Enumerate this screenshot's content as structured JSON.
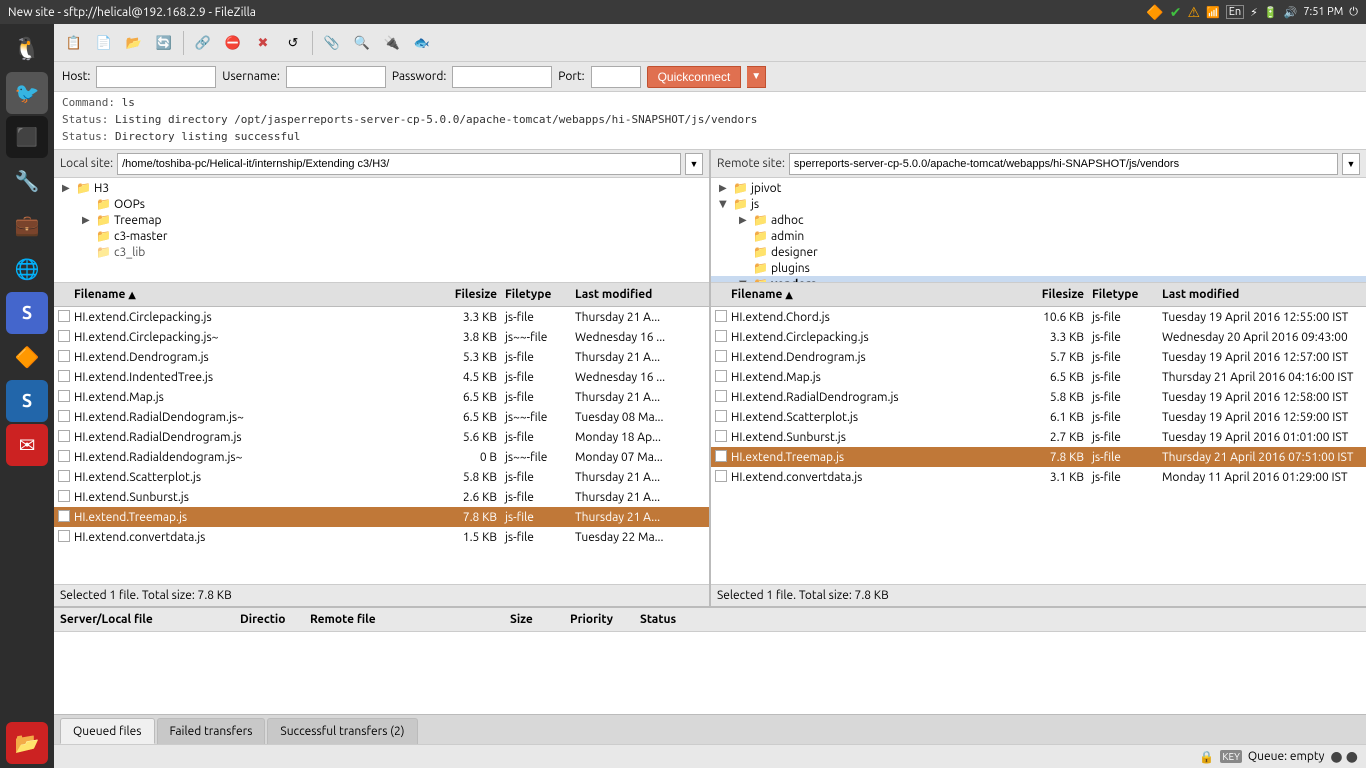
{
  "window": {
    "title": "New site - sftp://helical@192.168.2.9 - FileZilla"
  },
  "titlebar": {
    "time": "7:51 PM"
  },
  "toolbar": {
    "buttons": [
      "⚙",
      "📋",
      "▤",
      "🔁",
      "←",
      "→",
      "⛔",
      "✖",
      "↺",
      "📎",
      "🔍",
      "🔌",
      "🔒"
    ]
  },
  "connection": {
    "host_label": "Host:",
    "host_value": "",
    "username_label": "Username:",
    "username_value": "",
    "password_label": "Password:",
    "password_value": "",
    "port_label": "Port:",
    "port_value": "",
    "quickconnect": "Quickconnect"
  },
  "log": {
    "lines": [
      {
        "type": "command",
        "text": "Command:  ls"
      },
      {
        "type": "status",
        "label": "Status:",
        "text": "Listing directory /opt/jasperreports-server-cp-5.0.0/apache-tomcat/webapps/hi-SNAPSHOT/js/vendors"
      },
      {
        "type": "status",
        "label": "Status:",
        "text": "Directory listing successful"
      }
    ]
  },
  "local_pane": {
    "label": "Local site:",
    "path": "/home/toshiba-pc/Helical-it/internship/Extending c3/H3/",
    "tree": [
      {
        "level": 0,
        "arrow": "▶",
        "name": "H3",
        "expanded": false
      },
      {
        "level": 1,
        "arrow": "",
        "name": "OOPs",
        "expanded": false
      },
      {
        "level": 1,
        "arrow": "▶",
        "name": "Treemap",
        "expanded": false
      },
      {
        "level": 1,
        "arrow": "",
        "name": "c3-master",
        "expanded": false
      },
      {
        "level": 1,
        "arrow": "",
        "name": "c3_lib",
        "expanded": false
      }
    ],
    "columns": {
      "filename": "Filename",
      "filesize": "Filesize",
      "filetype": "Filetype",
      "modified": "Last modified"
    },
    "files": [
      {
        "name": "HI.extend.Circlepacking.js",
        "size": "3.3 KB",
        "type": "js-file",
        "modified": "Thursday 21 A..."
      },
      {
        "name": "HI.extend.Circlepacking.js~",
        "size": "3.8 KB",
        "type": "js~~-file",
        "modified": "Wednesday 16 ..."
      },
      {
        "name": "HI.extend.Dendrogram.js",
        "size": "5.3 KB",
        "type": "js-file",
        "modified": "Thursday 21 A..."
      },
      {
        "name": "HI.extend.IndentedTree.js",
        "size": "4.5 KB",
        "type": "js-file",
        "modified": "Wednesday 16 ..."
      },
      {
        "name": "HI.extend.Map.js",
        "size": "6.5 KB",
        "type": "js-file",
        "modified": "Thursday 21 A..."
      },
      {
        "name": "HI.extend.RadialDendogram.js~",
        "size": "6.5 KB",
        "type": "js~~-file",
        "modified": "Tuesday 08 Ma..."
      },
      {
        "name": "HI.extend.RadialDendrogram.js",
        "size": "5.6 KB",
        "type": "js-file",
        "modified": "Monday 18 Ap..."
      },
      {
        "name": "HI.extend.Radialdendogram.js~",
        "size": "0 B",
        "type": "js~~-file",
        "modified": "Monday 07 Ma..."
      },
      {
        "name": "HI.extend.Scatterplot.js",
        "size": "5.8 KB",
        "type": "js-file",
        "modified": "Thursday 21 A..."
      },
      {
        "name": "HI.extend.Sunburst.js",
        "size": "2.6 KB",
        "type": "js-file",
        "modified": "Thursday 21 A..."
      },
      {
        "name": "HI.extend.Treemap.js",
        "size": "7.8 KB",
        "type": "js-file",
        "modified": "Thursday 21 A...",
        "selected": true
      },
      {
        "name": "HI.extend.convertdata.js",
        "size": "1.5 KB",
        "type": "js-file",
        "modified": "Tuesday 22 Ma..."
      }
    ],
    "status": "Selected 1 file. Total size: 7.8 KB"
  },
  "remote_pane": {
    "label": "Remote site:",
    "path": "sperreports-server-cp-5.0.0/apache-tomcat/webapps/hi-SNAPSHOT/js/vendors",
    "tree": [
      {
        "level": 0,
        "arrow": "▶",
        "name": "jpivot",
        "expanded": false
      },
      {
        "level": 0,
        "arrow": "▼",
        "name": "js",
        "expanded": true
      },
      {
        "level": 1,
        "arrow": "▶",
        "name": "adhoc",
        "expanded": false
      },
      {
        "level": 1,
        "arrow": "",
        "name": "admin",
        "expanded": false
      },
      {
        "level": 1,
        "arrow": "",
        "name": "designer",
        "expanded": false
      },
      {
        "level": 1,
        "arrow": "",
        "name": "plugins",
        "expanded": false
      },
      {
        "level": 1,
        "arrow": "▼",
        "name": "vendors",
        "expanded": true,
        "selected": true
      }
    ],
    "columns": {
      "filename": "Filename",
      "filesize": "Filesize",
      "filetype": "Filetype",
      "modified": "Last modified"
    },
    "files": [
      {
        "name": "HI.extend.Chord.js",
        "size": "10.6 KB",
        "type": "js-file",
        "modified": "Tuesday 19 April 2016 12:55:00 IST"
      },
      {
        "name": "HI.extend.Circlepacking.js",
        "size": "3.3 KB",
        "type": "js-file",
        "modified": "Wednesday 20 April 2016 09:43:00"
      },
      {
        "name": "HI.extend.Dendrogram.js",
        "size": "5.7 KB",
        "type": "js-file",
        "modified": "Tuesday 19 April 2016 12:57:00 IST"
      },
      {
        "name": "HI.extend.Map.js",
        "size": "6.5 KB",
        "type": "js-file",
        "modified": "Thursday 21 April 2016 04:16:00 IST"
      },
      {
        "name": "HI.extend.RadialDendrogram.js",
        "size": "5.8 KB",
        "type": "js-file",
        "modified": "Tuesday 19 April 2016 12:58:00 IST"
      },
      {
        "name": "HI.extend.Scatterplot.js",
        "size": "6.1 KB",
        "type": "js-file",
        "modified": "Tuesday 19 April 2016 12:59:00 IST"
      },
      {
        "name": "HI.extend.Sunburst.js",
        "size": "2.7 KB",
        "type": "js-file",
        "modified": "Tuesday 19 April 2016 01:01:00 IST"
      },
      {
        "name": "HI.extend.Treemap.js",
        "size": "7.8 KB",
        "type": "js-file",
        "modified": "Thursday 21 April 2016 07:51:00 IST",
        "selected": true
      },
      {
        "name": "HI.extend.convertdata.js",
        "size": "3.1 KB",
        "type": "js-file",
        "modified": "Monday 11 April 2016 01:29:00 IST"
      }
    ],
    "status": "Selected 1 file. Total size: 7.8 KB"
  },
  "transfer_queue": {
    "columns": {
      "server_local": "Server/Local file",
      "direction": "Directio",
      "remote": "Remote file",
      "size": "Size",
      "priority": "Priority",
      "status": "Status"
    }
  },
  "bottom_tabs": {
    "tabs": [
      {
        "label": "Queued files",
        "active": true
      },
      {
        "label": "Failed transfers",
        "active": false
      },
      {
        "label": "Successful transfers (2)",
        "active": false
      }
    ]
  },
  "bottom_status": {
    "lock_icon": "🔒",
    "queue_label": "Queue: empty",
    "dots": "● ●"
  }
}
